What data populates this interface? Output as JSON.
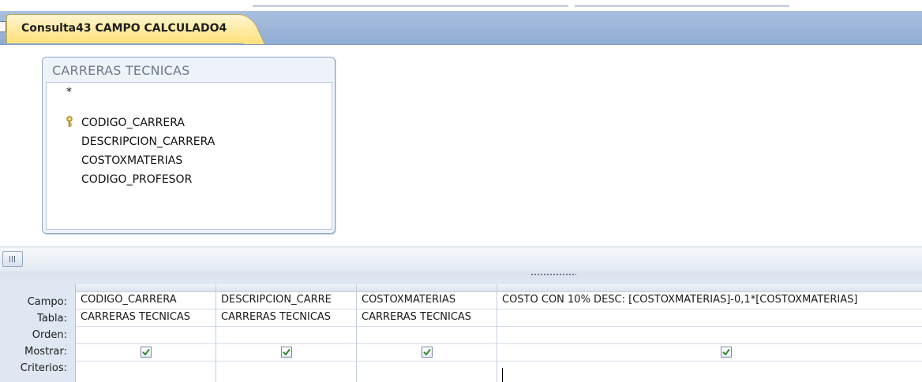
{
  "window": {
    "tab_title": "Consulta43 CAMPO CALCULADO4"
  },
  "table_box": {
    "title": "CARRERAS TECNICAS",
    "fields": [
      {
        "label": "*",
        "key": false
      },
      {
        "label": "CODIGO_CARRERA",
        "key": true
      },
      {
        "label": "DESCRIPCION_CARRERA",
        "key": false
      },
      {
        "label": "COSTOXMATERIAS",
        "key": false
      },
      {
        "label": "CODIGO_PROFESOR",
        "key": false
      }
    ]
  },
  "grid": {
    "row_labels": {
      "campo": "Campo:",
      "tabla": "Tabla:",
      "orden": "Orden:",
      "mostrar": "Mostrar:",
      "criterios": "Criterios:"
    },
    "columns": [
      {
        "campo": "CODIGO_CARRERA",
        "tabla": "CARRERAS TECNICAS",
        "orden": "",
        "mostrar": true,
        "criterios": ""
      },
      {
        "campo": "DESCRIPCION_CARRE",
        "tabla": "CARRERAS TECNICAS",
        "orden": "",
        "mostrar": true,
        "criterios": ""
      },
      {
        "campo": "COSTOXMATERIAS",
        "tabla": "CARRERAS TECNICAS",
        "orden": "",
        "mostrar": true,
        "criterios": ""
      },
      {
        "campo": "COSTO CON 10% DESC: [COSTOXMATERIAS]-0,1*[COSTOXMATERIAS]",
        "tabla": "",
        "orden": "",
        "mostrar": true,
        "criterios": ""
      }
    ]
  },
  "colors": {
    "tab_active": "#ffe07a",
    "tab_bar": "#9cb6da",
    "grid_bg": "#dfe7f2",
    "checkbox_check": "#2e8b2e"
  },
  "icons": {
    "key": "key-icon",
    "checkbox": "checkbox-checked-icon",
    "scroll_left": "scroll-left-icon",
    "splitter": "splitter-grip-icon"
  }
}
